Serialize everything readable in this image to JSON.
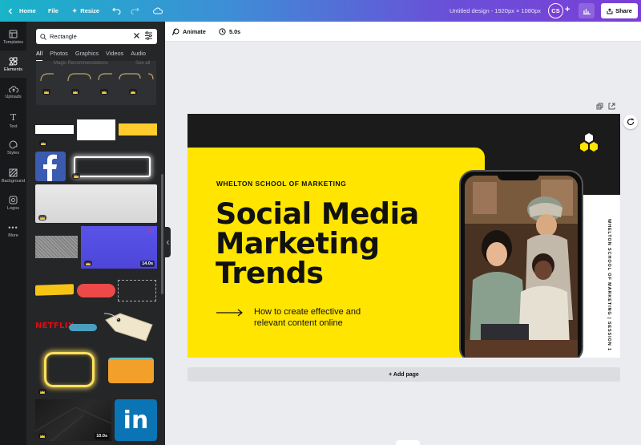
{
  "topbar": {
    "home": "Home",
    "file": "File",
    "resize": "Resize",
    "doc_title": "Untitled design - 1920px × 1080px",
    "avatar_initials": "CS",
    "share": "Share",
    "colors": {
      "gradient_start": "#18b4c8",
      "gradient_end": "#7a3fd6"
    }
  },
  "rail": [
    {
      "label": "Templates",
      "icon": "templates-icon"
    },
    {
      "label": "Elements",
      "icon": "elements-icon",
      "active": true
    },
    {
      "label": "Uploads",
      "icon": "uploads-icon"
    },
    {
      "label": "Text",
      "icon": "text-icon"
    },
    {
      "label": "Styles",
      "icon": "styles-icon"
    },
    {
      "label": "Background",
      "icon": "background-icon"
    },
    {
      "label": "Logos",
      "icon": "logos-icon"
    },
    {
      "label": "More",
      "icon": "more-icon"
    }
  ],
  "panel": {
    "search_value": "Rectangle",
    "tabs": [
      "All",
      "Photos",
      "Graphics",
      "Videos",
      "Audio"
    ],
    "active_tab": "All",
    "magic_label": "Magic Recommendations",
    "magic_size": "See all",
    "durations": {
      "video1": "14.0s",
      "video2": "10.0s"
    },
    "netflix": "NETFLIX",
    "linkedin": "in"
  },
  "toolbar": {
    "animate": "Animate",
    "duration": "5.0s"
  },
  "design": {
    "eyebrow": "WHELTON SCHOOL OF MARKETING",
    "headline_1": "Social Media",
    "headline_2": "Marketing",
    "headline_3": "Trends",
    "sub_1": "How to create effective and",
    "sub_2": "relevant content online",
    "vertical": "WHELTON SCHOOL OF MARKETING | SESSION 1",
    "colors": {
      "yellow": "#ffe500",
      "dark": "#1b1b1b"
    }
  },
  "add_page": "+ Add page"
}
